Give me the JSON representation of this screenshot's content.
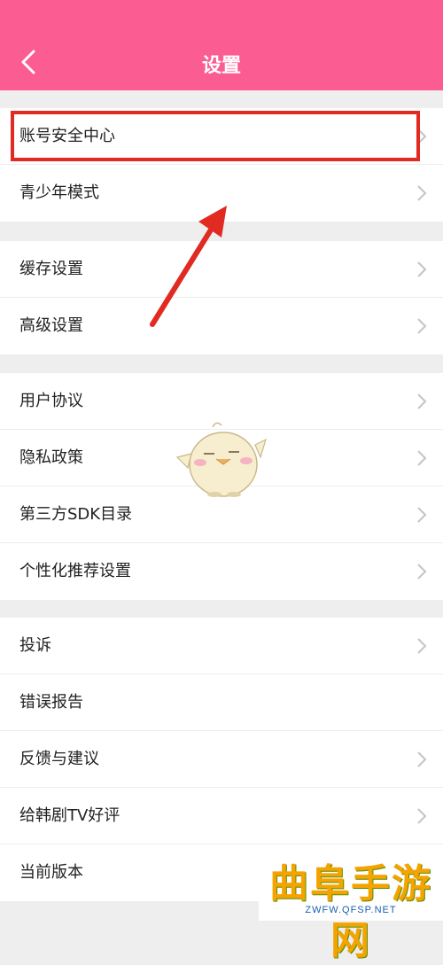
{
  "header": {
    "title": "设置"
  },
  "groups": [
    {
      "items": [
        {
          "label": "账号安全中心"
        },
        {
          "label": "青少年模式"
        }
      ]
    },
    {
      "items": [
        {
          "label": "缓存设置"
        },
        {
          "label": "高级设置"
        }
      ]
    },
    {
      "items": [
        {
          "label": "用户协议"
        },
        {
          "label": "隐私政策"
        },
        {
          "label": "第三方SDK目录"
        },
        {
          "label": "个性化推荐设置"
        }
      ]
    },
    {
      "items": [
        {
          "label": "投诉"
        },
        {
          "label": "错误报告"
        },
        {
          "label": "反馈与建议"
        },
        {
          "label": "给韩剧TV好评"
        },
        {
          "label": "当前版本"
        }
      ]
    }
  ],
  "watermark": {
    "text": "曲阜手游网",
    "url": "ZWFW.QFSP.NET"
  },
  "colors": {
    "header": "#fb5c92",
    "annotation": "#e02a22"
  }
}
